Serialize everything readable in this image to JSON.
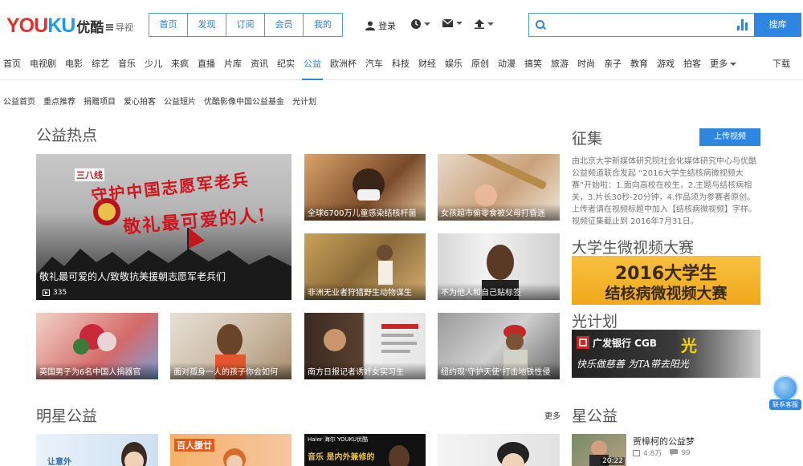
{
  "header": {
    "logo_en_a": "YOU",
    "logo_en_b": "KU",
    "logo_cn": "优酷",
    "guide_label": "导视",
    "tabs": [
      "首页",
      "发现",
      "订阅",
      "会员",
      "我的"
    ],
    "login_label": "登录",
    "search": {
      "placeholder": "",
      "button": "搜库"
    }
  },
  "channels": [
    "首页",
    "电视剧",
    "电影",
    "综艺",
    "音乐",
    "少儿",
    "来疯",
    "直播",
    "片库",
    "资讯",
    "纪实",
    "公益",
    "欧洲杯",
    "汽车",
    "科技",
    "财经",
    "娱乐",
    "原创",
    "动漫",
    "搞笑",
    "旅游",
    "时尚",
    "亲子",
    "教育",
    "游戏",
    "拍客"
  ],
  "channels_more": "更多",
  "channels_active": "公益",
  "download": "下载",
  "subnav": [
    "公益首页",
    "重点推荐",
    "捐赠项目",
    "爱心拍客",
    "公益短片",
    "优酷影像中国公益基金",
    "光计划"
  ],
  "hot": {
    "heading": "公益热点",
    "hero": {
      "badge": "三八线",
      "line1": "守护中国志愿军老兵",
      "line2": "敬礼最可爱的人!",
      "caption": "敬礼最可爱的人/致敬抗美援朝志愿军老兵们",
      "views": "335"
    },
    "cards": [
      "全球6700万儿童感染结核杆菌",
      "女孩超市偷零食被父母打昏迷",
      "非洲无业者狩猎野生动物谋生",
      "不为他人和自己贴标签",
      "英国男子为6名中国人捐器官",
      "面对孤身一人的孩子你会如何",
      "南方日报记者诱奸女实习生",
      "纽约现‘守护天使’打击地铁性侵"
    ]
  },
  "zhengji": {
    "heading": "征集",
    "upload": "上传视频",
    "desc": "由北京大学新媒体研究院社会化媒体研究中心与优酷公益频道联合发起 “2016大学生结核病微视频大赛”开始啦：1.面向高校在校生，2.主题与结核病相关，3.片长30秒-20分钟，4.作品须为参赛者原创。上传者请在视频标题中加入【结核病微视频】字样。视频征集截止到 2016年7月31日。"
  },
  "contest": {
    "heading": "大学生微视频大赛",
    "banner_l1": "2016大学生",
    "banner_l2": "结核病微视频大赛"
  },
  "light": {
    "heading": "光计划",
    "bank": "广发银行 CGB",
    "guang": "光",
    "slogan": "快乐做慈善 为TA带去阳光"
  },
  "stars": {
    "heading": "明星公益",
    "more": "更多",
    "card1_text": "让意外",
    "card2_text": "百人援廿",
    "card3_brand": "Haier 海尔 YOUKU优酷",
    "card3_text": "音乐 是内外兼修的"
  },
  "xing": {
    "heading": "星公益",
    "item_title": "贾樟柯的公益梦",
    "duration": "20:22",
    "views": "4.8万",
    "comments": "99"
  },
  "kefu": "联系客服",
  "colors": {
    "accent": "#2f86e0",
    "logo_red": "#e3302b",
    "logo_blue": "#1f9ce6"
  }
}
